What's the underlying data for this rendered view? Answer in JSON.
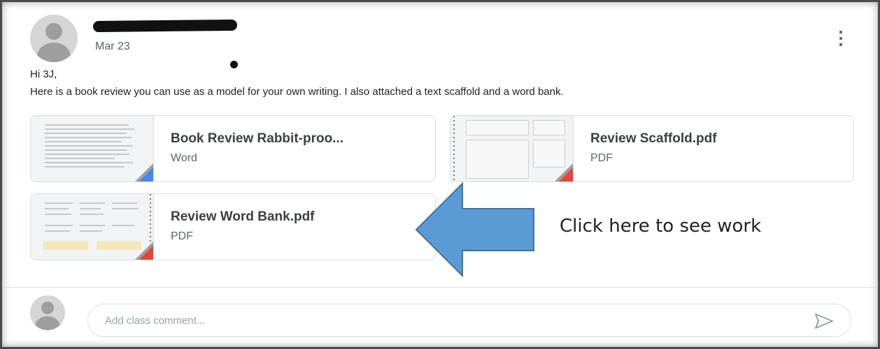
{
  "post": {
    "date": "Mar 23",
    "greeting": "Hi 3J,",
    "message": "Here is a book review you can use as a model for your own writing. I also attached a text scaffold and a word bank."
  },
  "attachments": [
    {
      "title": "Book Review Rabbit-proo...",
      "type": "Word",
      "icon": "word-badge",
      "color": "#4285f4"
    },
    {
      "title": "Review Scaffold.pdf",
      "type": "PDF",
      "icon": "pdf-badge",
      "color": "#ea4335"
    },
    {
      "title": "Review Word Bank.pdf",
      "type": "PDF",
      "icon": "pdf-badge",
      "color": "#ea4335"
    }
  ],
  "callout": {
    "text": "Click here to see work",
    "arrow_color": "#5b9bd5"
  },
  "comment": {
    "placeholder": "Add class comment..."
  },
  "icons": {
    "more": "more-vert-icon",
    "send": "send-icon",
    "avatar": "avatar-icon"
  }
}
